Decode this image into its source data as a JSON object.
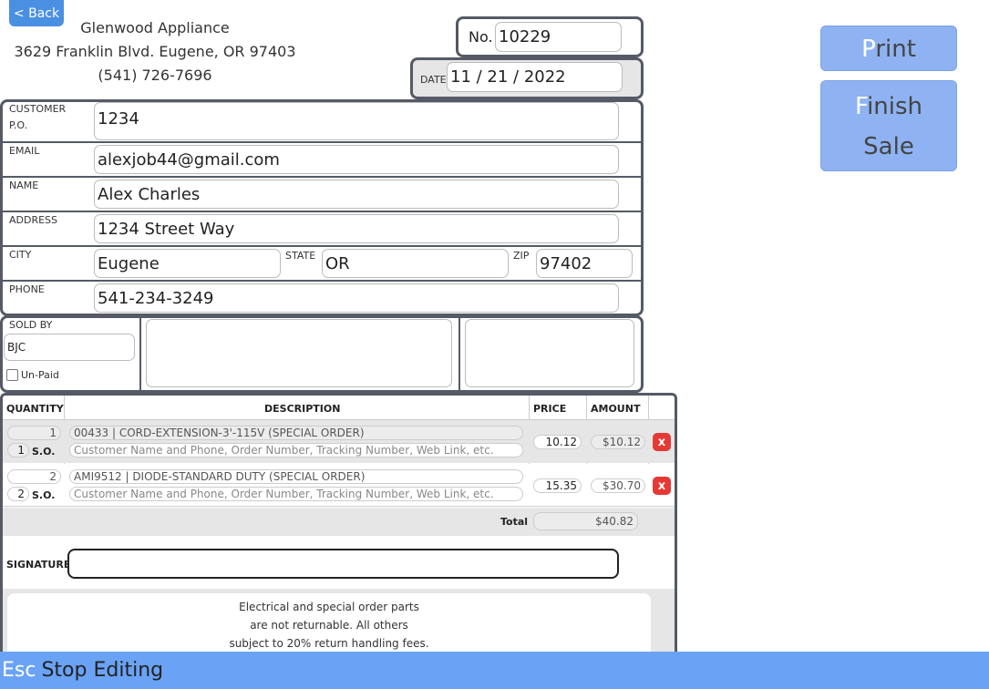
{
  "nav": {
    "back_label": "< Back"
  },
  "store": {
    "name": "Glenwood Appliance",
    "address": "3629 Franklin Blvd. Eugene, OR 97403",
    "phone": "(541) 726-7696"
  },
  "invoice": {
    "number_label": "No.",
    "number": "10229",
    "date_label": "DATE",
    "date": "11 / 21 / 2022"
  },
  "actions": {
    "print_first": "P",
    "print_rest": "rint",
    "finish_first": "F",
    "finish_rest": "inish",
    "finish_line2": "Sale"
  },
  "customer": {
    "po_label_1": "CUSTOMER",
    "po_label_2": "P.O.",
    "po": "1234",
    "email_label": "EMAIL",
    "email": "alexjob44@gmail.com",
    "name_label": "NAME",
    "name": "Alex Charles",
    "address_label": "ADDRESS",
    "address": "1234 Street Way",
    "city_label": "CITY",
    "city": "Eugene",
    "state_label": "STATE",
    "state": "OR",
    "zip_label": "ZIP",
    "zip": "97402",
    "phone_label": "PHONE",
    "phone": "541-234-3249"
  },
  "sale": {
    "sold_by_label": "SOLD BY",
    "sold_by": "BJC",
    "unpaid_label": "Un-Paid"
  },
  "table": {
    "headers": {
      "quantity": "QUANTITY",
      "description": "DESCRIPTION",
      "price": "PRICE",
      "amount": "AMOUNT"
    },
    "so_label": "S.O.",
    "notes_placeholder": "Customer Name and Phone, Order Number, Tracking Number, Web Link, etc.",
    "rows": [
      {
        "qty": "1",
        "so_qty": "1",
        "description": "00433 | CORD-EXTENSION-3'-115V (SPECIAL ORDER)",
        "price": "10.12",
        "amount": "$10.12",
        "delete": "x"
      },
      {
        "qty": "2",
        "so_qty": "2",
        "description": "AMI9512 | DIODE-STANDARD DUTY (SPECIAL ORDER)",
        "price": "15.35",
        "amount": "$30.70",
        "delete": "x"
      }
    ],
    "total_label": "Total",
    "total": "$40.82"
  },
  "signature": {
    "label": "SIGNATURE",
    "value": ""
  },
  "policy": {
    "line1": "Electrical and special order parts",
    "line2": "are not returnable. All others",
    "line3": "subject to 20% return handling fees."
  },
  "footer": {
    "key": "Esc",
    "label": "Stop Editing"
  },
  "colors": {
    "accent": "#4a90e2",
    "button": "#8fb3f2",
    "footer": "#6aa3f5",
    "delete": "#e53935",
    "border": "#555a66"
  }
}
